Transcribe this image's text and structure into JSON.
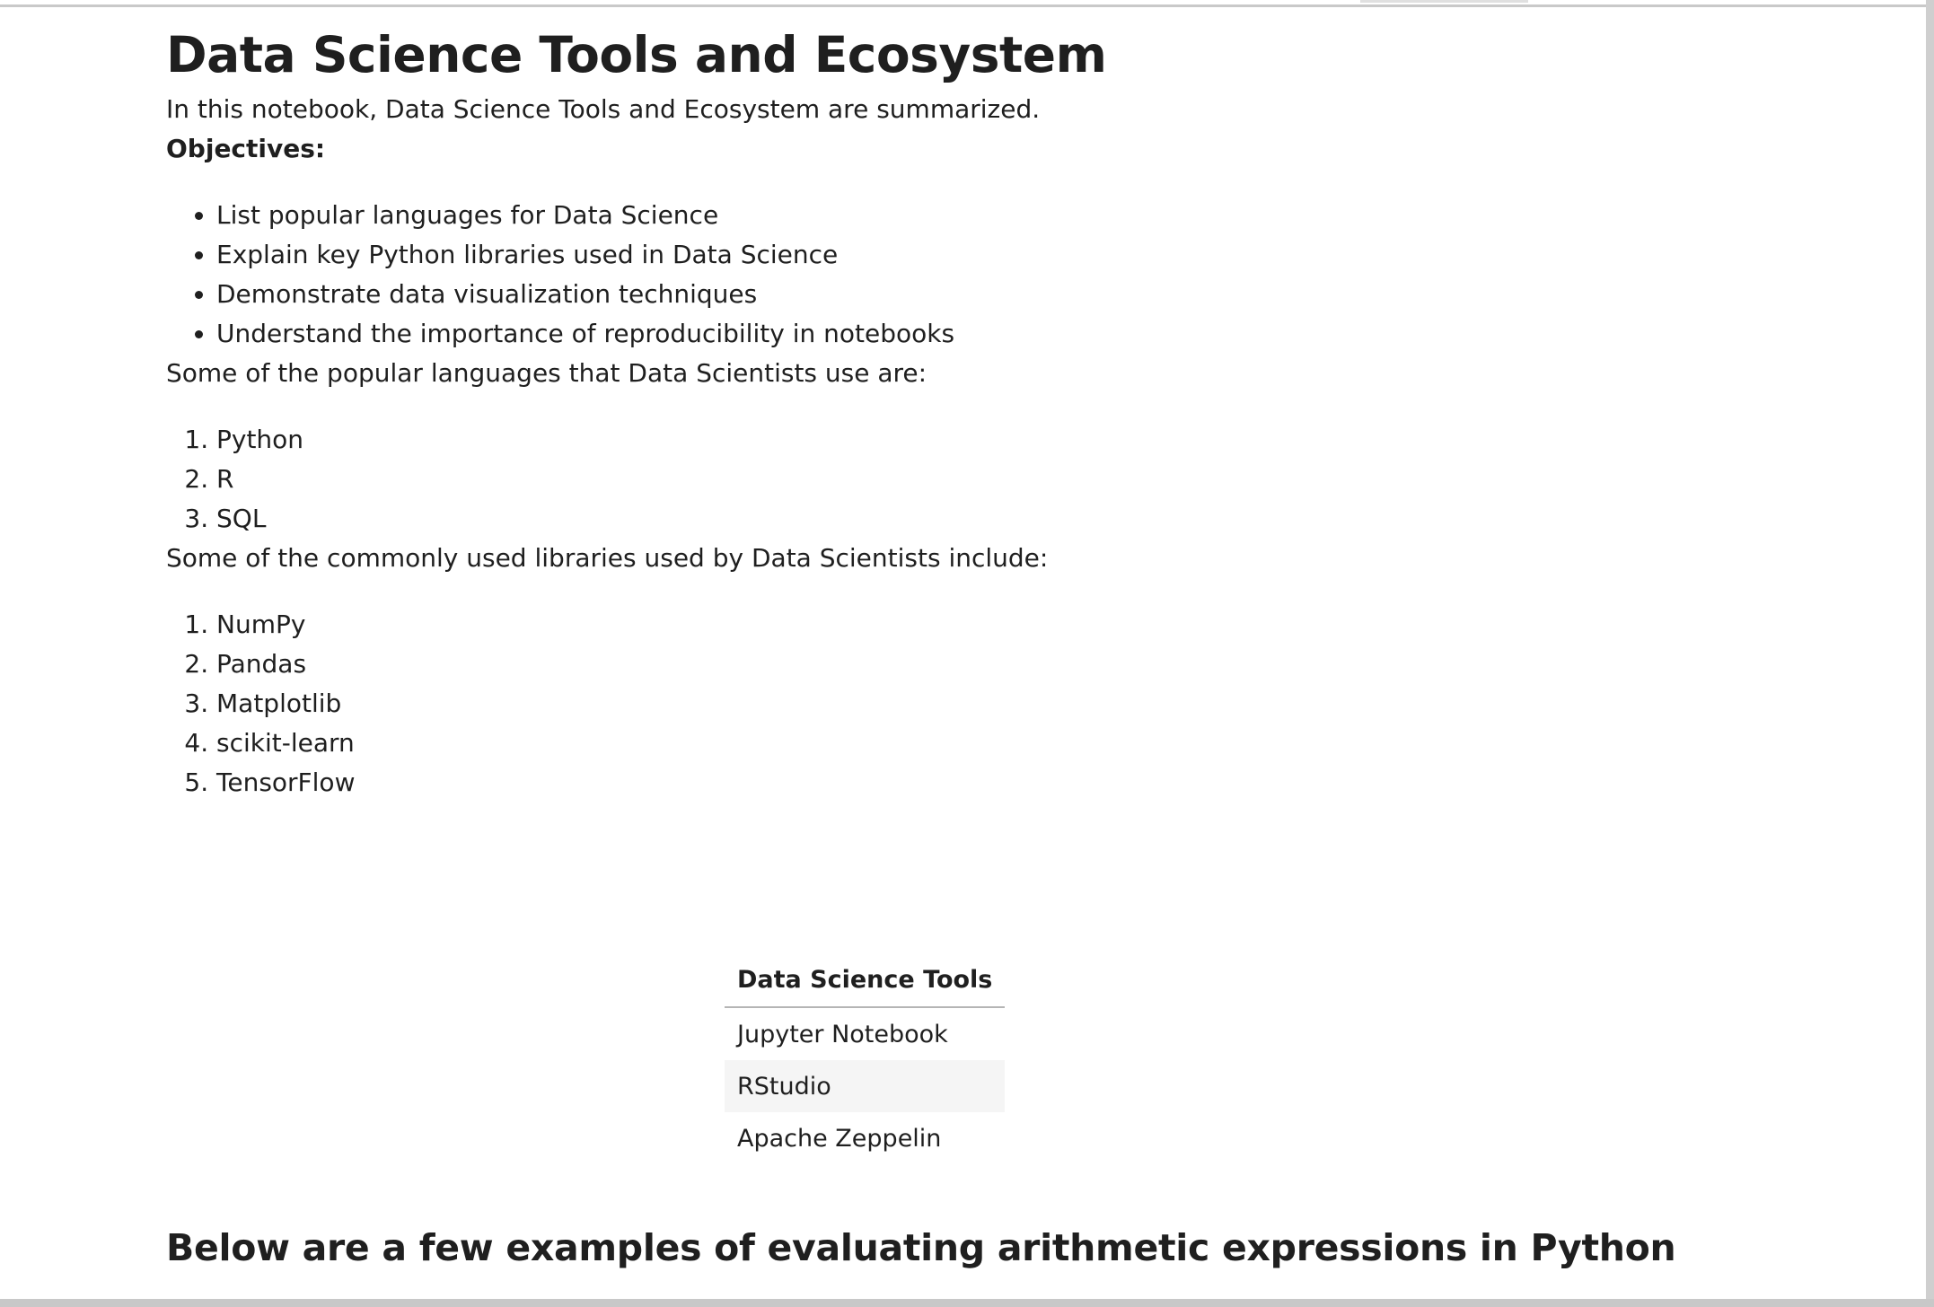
{
  "notebook": {
    "title": "Data Science Tools and Ecosystem",
    "intro": "In this notebook, Data Science Tools and Ecosystem are summarized.",
    "objectives_label": "Objectives:",
    "objectives": [
      "List popular languages for Data Science",
      "Explain key Python libraries used in Data Science",
      "Demonstrate data visualization techniques",
      "Understand the importance of reproducibility in notebooks"
    ],
    "languages_intro": "Some of the popular languages that Data Scientists use are:",
    "languages": [
      "Python",
      "R",
      "SQL"
    ],
    "libraries_intro": "Some of the commonly used libraries used by Data Scientists include:",
    "libraries": [
      "NumPy",
      "Pandas",
      "Matplotlib",
      "scikit-learn",
      "TensorFlow"
    ],
    "tools_table": {
      "header": "Data Science Tools",
      "rows": [
        "Jupyter Notebook",
        "RStudio",
        "Apache Zeppelin"
      ]
    },
    "arithmetic_heading": "Below are a few examples of evaluating arithmetic expressions in Python"
  }
}
